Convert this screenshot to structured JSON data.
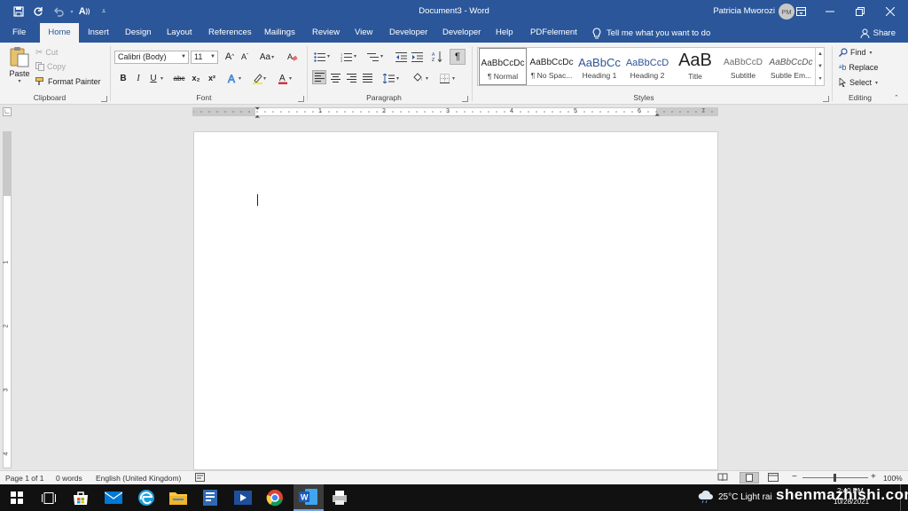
{
  "app": {
    "document_title": "Document3",
    "separator": "-",
    "app_name": "Word",
    "user_name": "Patricia Mworozi",
    "user_initials": "PM",
    "accent_color": "#2b579a"
  },
  "quick_access": {
    "icons": [
      "save-icon",
      "repeat-icon",
      "undo-icon",
      "read-aloud-icon",
      "customize-icon"
    ]
  },
  "tabs": [
    {
      "label": "File"
    },
    {
      "label": "Home",
      "active": true
    },
    {
      "label": "Insert"
    },
    {
      "label": "Design"
    },
    {
      "label": "Layout"
    },
    {
      "label": "References"
    },
    {
      "label": "Mailings"
    },
    {
      "label": "Review"
    },
    {
      "label": "View"
    },
    {
      "label": "Developer"
    },
    {
      "label": "Developer"
    },
    {
      "label": "Help"
    },
    {
      "label": "PDFelement"
    }
  ],
  "tell_me": "Tell me what you want to do",
  "share": "Share",
  "clipboard": {
    "label": "Clipboard",
    "paste": "Paste",
    "cut": "Cut",
    "copy": "Copy",
    "format_painter": "Format Painter"
  },
  "font": {
    "label": "Font",
    "font_name": "Calibri (Body)",
    "font_size": "11",
    "case_button": "Aa",
    "bold": "B",
    "italic": "I",
    "underline": "U",
    "strikethrough": "abc",
    "subscript": "x₂",
    "superscript": "x²",
    "font_color": "#d13438",
    "highlight_color": "#f4e842"
  },
  "paragraph": {
    "label": "Paragraph"
  },
  "styles": {
    "label": "Styles",
    "items": [
      {
        "preview": "AaBbCcDc",
        "name": "¶ Normal",
        "selected": true
      },
      {
        "preview": "AaBbCcDc",
        "name": "¶ No Spac..."
      },
      {
        "preview": "AaBbCc",
        "name": "Heading 1"
      },
      {
        "preview": "AaBbCcD",
        "name": "Heading 2"
      },
      {
        "preview": "AaB",
        "name": "Title"
      },
      {
        "preview": "AaBbCcD",
        "name": "Subtitle"
      },
      {
        "preview": "AaBbCcDc",
        "name": "Subtle Em..."
      }
    ]
  },
  "editing": {
    "label": "Editing",
    "find": "Find",
    "replace": "Replace",
    "select": "Select"
  },
  "ruler": {
    "marks": [
      "1",
      "1",
      "2",
      "3",
      "4",
      "5",
      "6",
      "7"
    ],
    "vmarks": [
      "1",
      "2",
      "3",
      "4"
    ]
  },
  "status": {
    "page": "Page 1 of 1",
    "words": "0 words",
    "language": "English (United Kingdom)",
    "zoom": "100%",
    "zoom_minus": "−",
    "zoom_plus": "+"
  },
  "taskbar": {
    "weather": "25°C  Light rai",
    "watermark": "shenmazhishi.com",
    "time": "2:40 PM",
    "date": "10/28/2021"
  }
}
